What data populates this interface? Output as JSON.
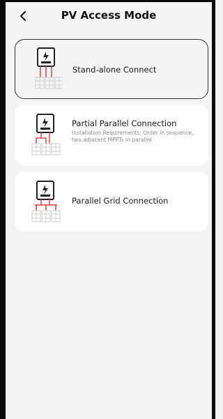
{
  "header": {
    "back_icon": "chevron-left-icon",
    "title": "PV Access Mode"
  },
  "options": [
    {
      "label": "Stand-alone Connect",
      "selected": true,
      "icon": "standalone-connection-icon"
    },
    {
      "label": "Partial Parallel Connection",
      "sub": "Installation Requirements: Order in sequence, two adjacent MPPTs in parallel",
      "selected": false,
      "icon": "partial-parallel-connection-icon"
    },
    {
      "label": "Parallel Grid Connection",
      "selected": false,
      "icon": "parallel-grid-connection-icon"
    }
  ],
  "colors": {
    "accent_red": "#e0403f",
    "panel_gray": "#cfcfcf",
    "background": "#f4f4f4"
  }
}
